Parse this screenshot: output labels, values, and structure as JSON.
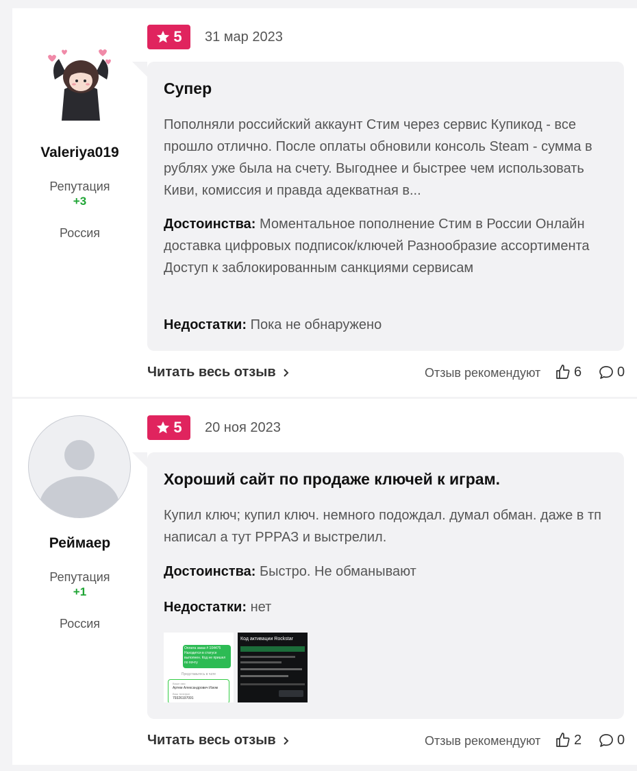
{
  "reviews": [
    {
      "user": "Valeriya019",
      "reputation_label": "Репутация",
      "reputation": "+3",
      "country": "Россия",
      "rating": "5",
      "date": "31 мар 2023",
      "title": "Супер",
      "text": "Пополняли российский аккаунт Стим через сервис Купикод - все прошло отлично. После оплаты обновили консоль Steam - сумма в рублях уже была на счету. Выгоднее и быстрее чем использовать Киви, комиссия и правда адекватная в...",
      "pros_label": "Достоинства:",
      "pros": "Моментальное пополнение Стим в России Онлайн доставка цифровых подписок/ключей Разнообразие ассортимента Доступ к заблокированным санкциями сервисам",
      "cons_label": "Недостатки:",
      "cons": "Пока не обнаружено",
      "read_more": "Читать весь отзыв",
      "recommend_label": "Отзыв рекомендуют",
      "likes": "6",
      "comments": "0"
    },
    {
      "user": "Реймаер",
      "reputation_label": "Репутация",
      "reputation": "+1",
      "country": "Россия",
      "rating": "5",
      "date": "20 ноя 2023",
      "title": "Хороший сайт по продаже ключей к играм.",
      "text": "Купил ключ; купил ключ. немного подождал. думал обман. даже в тп написал а тут РРРАЗ и выстрелил.",
      "pros_label": "Достоинства:",
      "pros": "Быстро. Не обманывают",
      "cons_label": "Недостатки:",
      "cons": "нет",
      "read_more": "Читать весь отзыв",
      "recommend_label": "Отзыв рекомендуют",
      "likes": "2",
      "comments": "0",
      "thumb1": {
        "bubble": "Оплата заказ # 104475 Находится в статусе выполнен. Код не пришел по почту",
        "divider": "Представьтесь в чате",
        "name_label": "Ваше имя",
        "name_value": "Артем Александрович Изюм",
        "phone_label": "Ваш телефон",
        "phone_value": "79326197091"
      },
      "thumb2": {
        "header": "Код активации Rockstar"
      }
    }
  ],
  "colors": {
    "badge": "#e0245e",
    "reputation": "#1fa535",
    "card_bg": "#f2f2f4",
    "page_bg": "#f3f3f5"
  }
}
